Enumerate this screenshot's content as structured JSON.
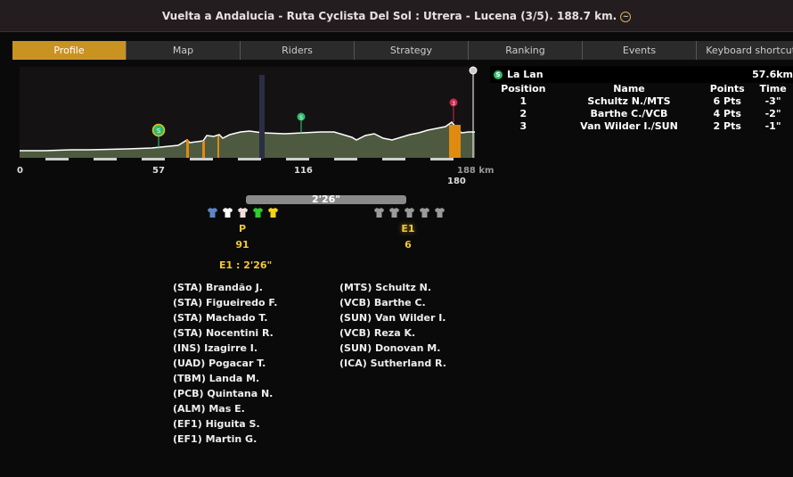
{
  "window": {
    "title": "Vuelta a Andalucia - Ruta Cyclista Del Sol : Utrera - Lucena (3/5). 188.7 km.",
    "title_icon": "weather-icon"
  },
  "tabs": [
    {
      "label": "Profile",
      "active": true
    },
    {
      "label": "Map"
    },
    {
      "label": "Riders"
    },
    {
      "label": "Strategy"
    },
    {
      "label": "Ranking"
    },
    {
      "label": "Events"
    },
    {
      "label": "Keyboard shortcuts"
    }
  ],
  "profile": {
    "axis": {
      "start": "0",
      "km57": "57",
      "km116": "116",
      "end": "188 km",
      "km180": "180"
    },
    "markers": {
      "sprint1": "S",
      "sprint2": "S",
      "kom": "3"
    }
  },
  "sprint": {
    "icon": "S",
    "name": "La Lan",
    "km": "57.6km",
    "columns": [
      "Position",
      "Name",
      "Points",
      "Time"
    ],
    "rows": [
      [
        "1",
        "Schultz N./MTS",
        "6 Pts",
        "-3\""
      ],
      [
        "2",
        "Barthe C./VCB",
        "4 Pts",
        "-2\""
      ],
      [
        "3",
        "Van Wilder I./SUN",
        "2 Pts",
        "-1\""
      ]
    ]
  },
  "groups": {
    "gap": "2'26\"",
    "peloton": {
      "label": "P",
      "count": "91",
      "jerseys": [
        "#5f86c4",
        "#ffffff",
        "#f3dede",
        "#2fcc2f",
        "#f5d315"
      ]
    },
    "escape": {
      "label": "E1",
      "count": "6",
      "jerseys": [
        "#9a9a9a",
        "#9a9a9a",
        "#9a9a9a",
        "#9a9a9a",
        "#9a9a9a"
      ]
    },
    "summary": "E1 : 2'26\""
  },
  "peloton_riders": [
    "(STA) Brandão J.",
    "(STA) Figueiredo F.",
    "(STA) Machado T.",
    "(STA) Nocentini R.",
    "(INS) Izagirre I.",
    "(UAD) Pogacar T.",
    "(TBM) Landa M.",
    "(PCB) Quintana N.",
    "(ALM) Mas E.",
    "(EF1) Higuita S.",
    "(EF1) Martin G."
  ],
  "escape_riders": [
    "(MTS) Schultz N.",
    "(VCB) Barthe C.",
    "(SUN) Van Wilder I.",
    "(VCB) Reza K.",
    "(SUN) Donovan M.",
    "(ICA) Sutherland R."
  ]
}
